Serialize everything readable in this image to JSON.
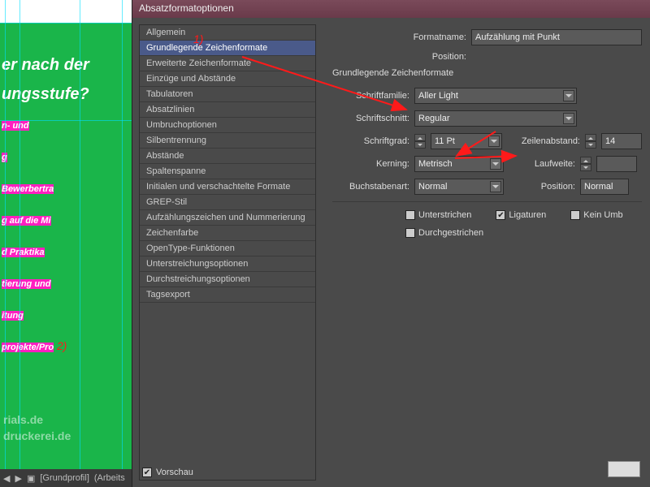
{
  "document": {
    "lines": [
      {
        "text": "er nach der",
        "hl": false
      },
      {
        "text": "ungsstufe?",
        "hl": false
      },
      {
        "text": "n- und",
        "hl": true
      },
      {
        "text": "g",
        "hl": true
      },
      {
        "text": "Bewerbertra",
        "hl": true
      },
      {
        "text": "g auf die Mi",
        "hl": true
      },
      {
        "text": "d Praktika",
        "hl": true
      },
      {
        "text": "tierung und",
        "hl": true
      },
      {
        "text": "itung",
        "hl": true
      },
      {
        "text": "projekte/Pro",
        "hl": true
      }
    ],
    "logo1": "rials.de",
    "logo2": "druckerei.de",
    "status_profile": "[Grundprofil]",
    "status_doc": "(Arbeits"
  },
  "annotations": {
    "a1": "1)",
    "a2": "2)"
  },
  "dialog": {
    "title": "Absatzformatoptionen",
    "categories": [
      "Allgemein",
      "Grundlegende Zeichenformate",
      "Erweiterte Zeichenformate",
      "Einzüge und Abstände",
      "Tabulatoren",
      "Absatzlinien",
      "Umbruchoptionen",
      "Silbentrennung",
      "Abstände",
      "Spaltenspanne",
      "Initialen und verschachtelte Formate",
      "GREP-Stil",
      "Aufzählungszeichen und Nummerierung",
      "Zeichenfarbe",
      "OpenType-Funktionen",
      "Unterstreichungsoptionen",
      "Durchstreichungsoptionen",
      "Tagsexport"
    ],
    "selected_index": 1,
    "header": {
      "formatname_label": "Formatname:",
      "formatname_value": "Aufzählung mit Punkt",
      "position_label": "Position:"
    },
    "section_title": "Grundlegende Zeichenformate",
    "fields": {
      "family_label": "Schriftfamilie:",
      "family_value": "Aller Light",
      "style_label": "Schriftschnitt:",
      "style_value": "Regular",
      "size_label": "Schriftgrad:",
      "size_value": "11 Pt",
      "leading_label": "Zeilenabstand:",
      "leading_value": "14",
      "kerning_label": "Kerning:",
      "kerning_value": "Metrisch",
      "tracking_label": "Laufweite:",
      "tracking_value": "",
      "case_label": "Buchstabenart:",
      "case_value": "Normal",
      "position_label": "Position:",
      "position_value": "Normal"
    },
    "checks": {
      "underline": "Unterstrichen",
      "ligatures": "Ligaturen",
      "nobreak": "Kein Umb",
      "strike": "Durchgestrichen"
    },
    "preview_label": "Vorschau"
  }
}
